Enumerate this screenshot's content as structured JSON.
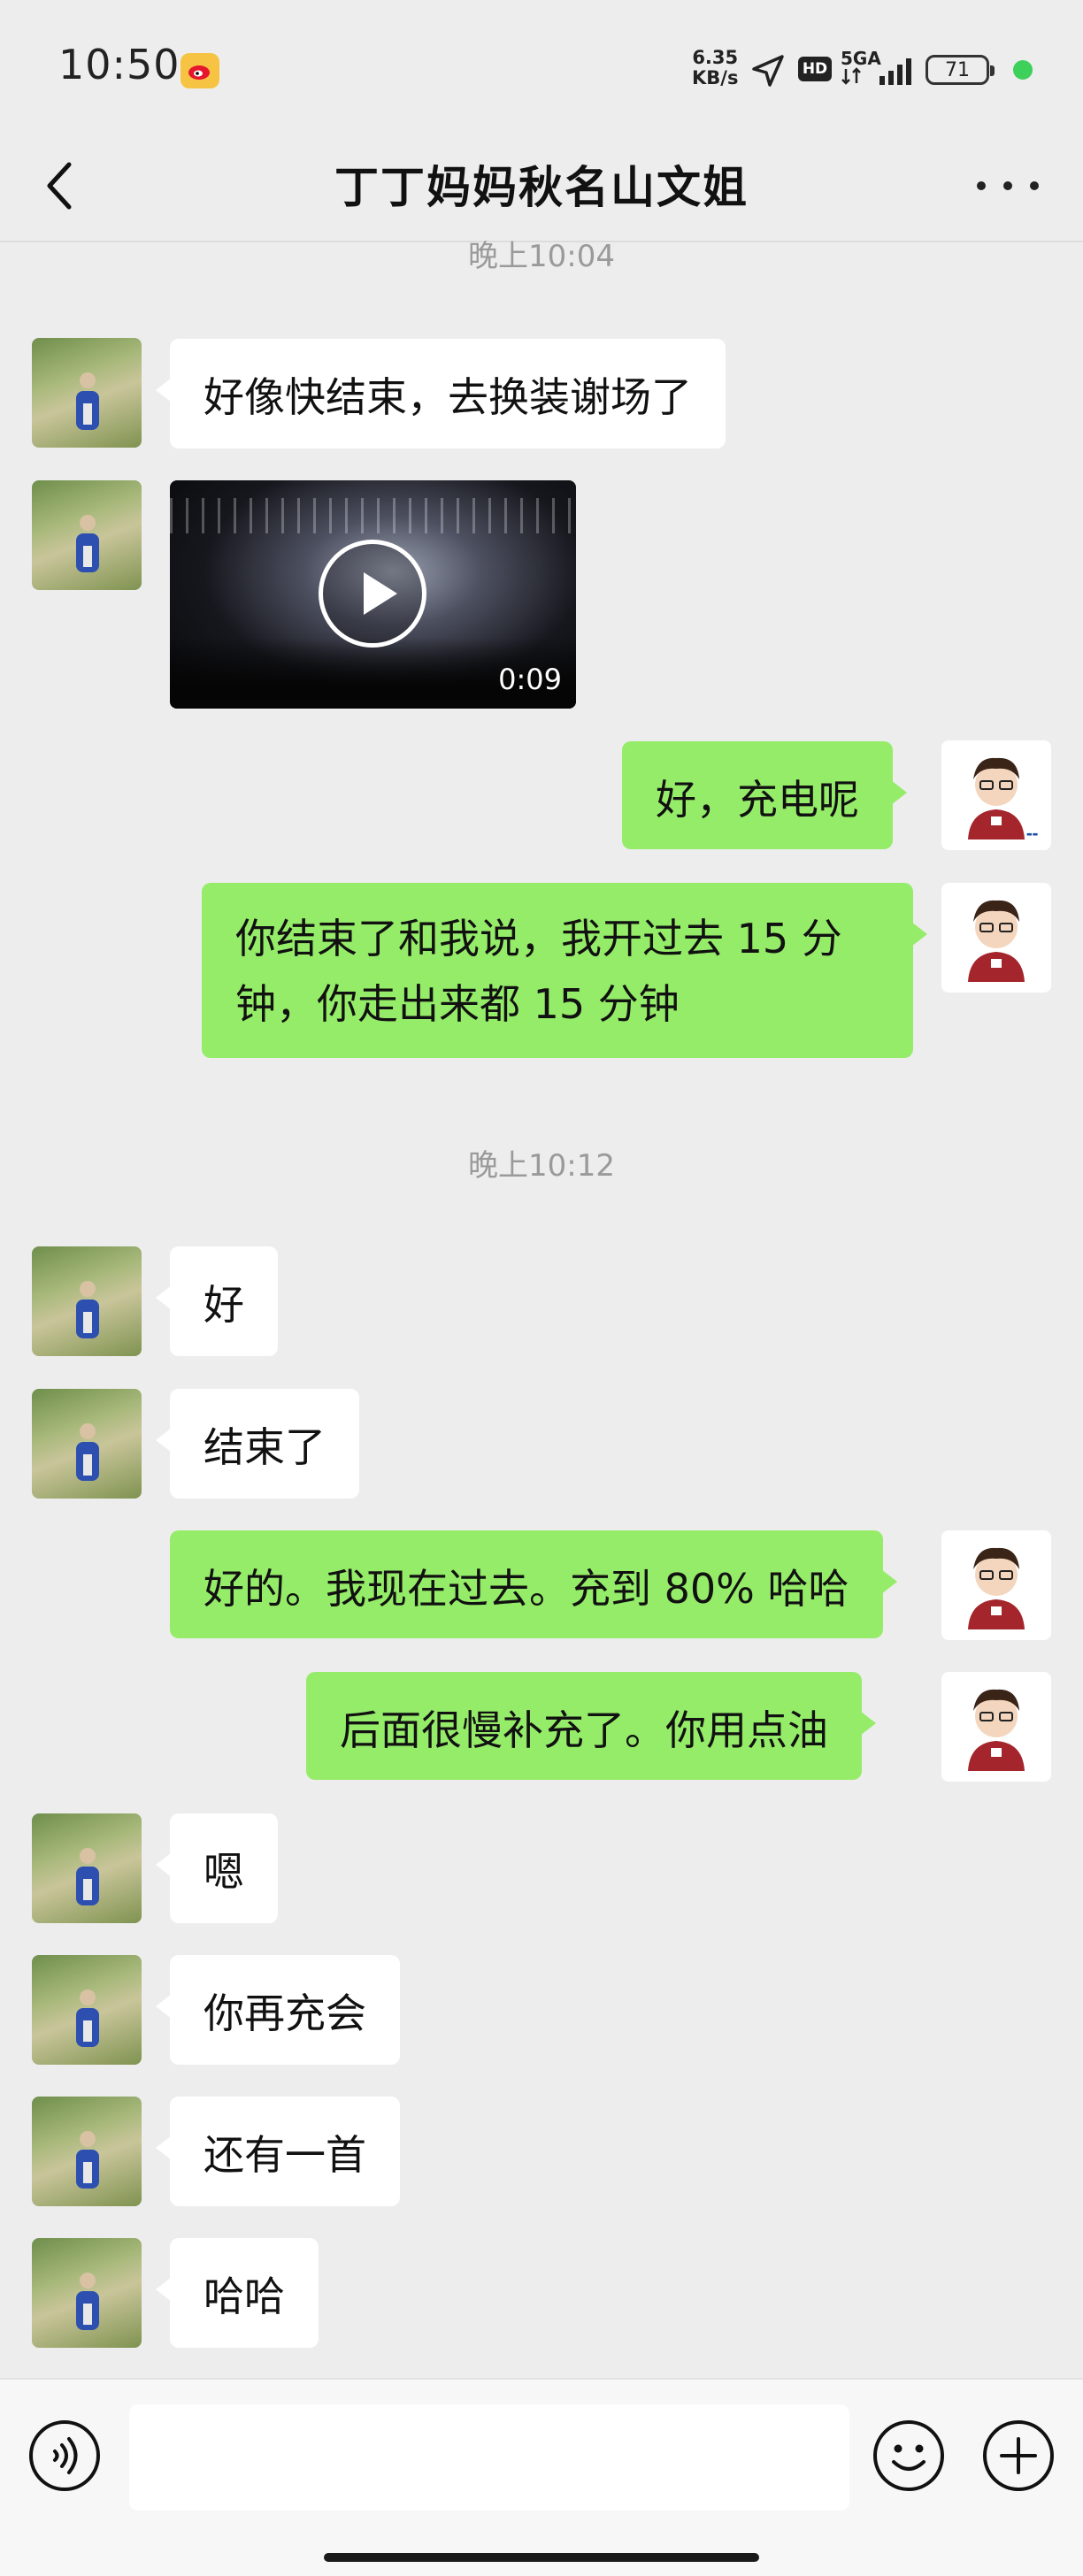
{
  "status_bar": {
    "time": "10:50",
    "net_speed_value": "6.35",
    "net_speed_unit": "KB/s",
    "hd_badge": "HD",
    "network": "5GA",
    "battery": "71"
  },
  "header": {
    "title": "丁丁妈妈秋名山文姐"
  },
  "timestamps": [
    "晚上10:04",
    "晚上10:12"
  ],
  "messages": [
    {
      "side": "left",
      "text": "好像快结束，去换装谢场了"
    },
    {
      "side": "left",
      "type": "video",
      "duration": "0:09"
    },
    {
      "side": "right",
      "text": "好，充电呢"
    },
    {
      "side": "right",
      "text": "你结束了和我说，我开过去 15 分钟，你走出来都 15 分钟"
    },
    {
      "side": "left",
      "text": "好"
    },
    {
      "side": "left",
      "text": "结束了"
    },
    {
      "side": "right",
      "text": "好的。我现在过去。充到 80% 哈哈"
    },
    {
      "side": "right",
      "text": "后面很慢补充了。你用点油"
    },
    {
      "side": "left",
      "text": "嗯"
    },
    {
      "side": "left",
      "text": "你再充会"
    },
    {
      "side": "left",
      "text": "还有一首"
    },
    {
      "side": "left",
      "text": "哈哈"
    }
  ],
  "input_bar": {
    "message_value": "",
    "icons": [
      "voice-icon",
      "emoji-icon",
      "add-icon"
    ]
  },
  "icons": {
    "back": "back-arrow-icon",
    "more": "more-dots-icon",
    "status": [
      "weibo-icon",
      "location-icon",
      "signal-icon",
      "battery-icon"
    ]
  },
  "colors": {
    "background": "#ededed",
    "bubble_self": "#95ec69",
    "bubble_other": "#ffffff",
    "timestamp": "#9a9a9a"
  }
}
